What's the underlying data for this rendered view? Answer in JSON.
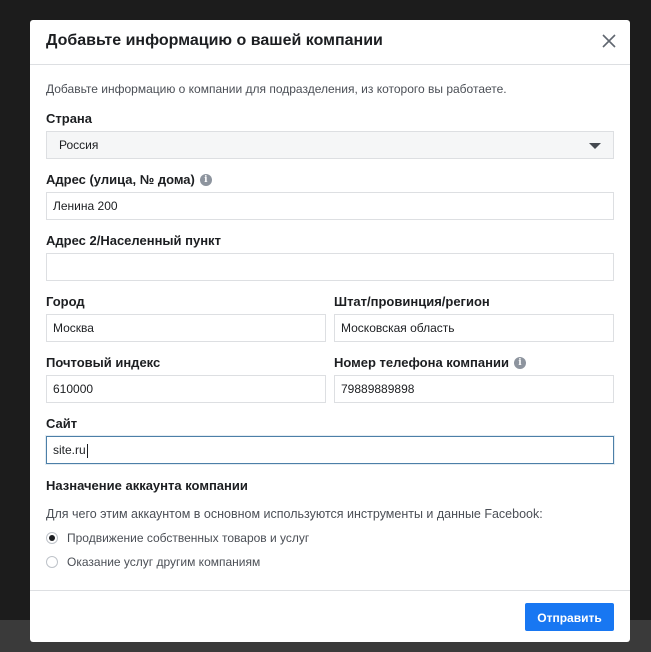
{
  "modal": {
    "title": "Добавьте информацию о вашей компании",
    "intro": "Добавьте информацию о компании для подразделения, из которого вы работаете."
  },
  "form": {
    "country": {
      "label": "Страна",
      "value": "Россия"
    },
    "address": {
      "label": "Адрес (улица, № дома)",
      "value": "Ленина 200"
    },
    "address2": {
      "label": "Адрес 2/Населенный пункт",
      "value": ""
    },
    "city": {
      "label": "Город",
      "value": "Москва"
    },
    "region": {
      "label": "Штат/провинция/регион",
      "value": "Московская область"
    },
    "postal": {
      "label": "Почтовый индекс",
      "value": "610000"
    },
    "phone": {
      "label": "Номер телефона компании",
      "value": "79889889898"
    },
    "site": {
      "label": "Сайт",
      "value": "site.ru"
    }
  },
  "purpose": {
    "title": "Назначение аккаунта компании",
    "question": "Для чего этим аккаунтом в основном используются инструменты и данные Facebook:",
    "options": [
      {
        "label": "Продвижение собственных товаров и услуг",
        "checked": true
      },
      {
        "label": "Оказание услуг другим компаниям",
        "checked": false
      }
    ]
  },
  "footer": {
    "submit_label": "Отправить"
  },
  "icons": {
    "info": "i"
  },
  "colors": {
    "accent": "#1877f2",
    "overlay": "#1c1c1c"
  }
}
